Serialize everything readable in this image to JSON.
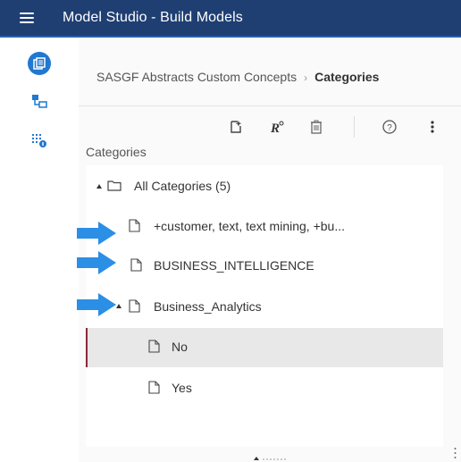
{
  "header": {
    "title": "Model Studio - Build Models"
  },
  "breadcrumb": {
    "parent": "SASGF Abstracts Custom Concepts",
    "separator": "›",
    "current": "Categories"
  },
  "toolbar": {
    "icons": [
      "new-category-icon",
      "rename-icon",
      "delete-icon",
      "help-icon",
      "more-options-icon"
    ]
  },
  "panel": {
    "label": "Categories"
  },
  "tree": {
    "root": {
      "label": "All Categories (5)"
    },
    "items": [
      {
        "label": "+customer, text, text mining, +bu..."
      },
      {
        "label": "BUSINESS_INTELLIGENCE"
      },
      {
        "label": "Business_Analytics"
      },
      {
        "label": "No"
      },
      {
        "label": "Yes"
      }
    ]
  },
  "colors": {
    "header_bg": "#1f3f73",
    "accent": "#1f78d1",
    "arrow": "#2b8fe6",
    "selected_bg": "#e8e8e8"
  }
}
